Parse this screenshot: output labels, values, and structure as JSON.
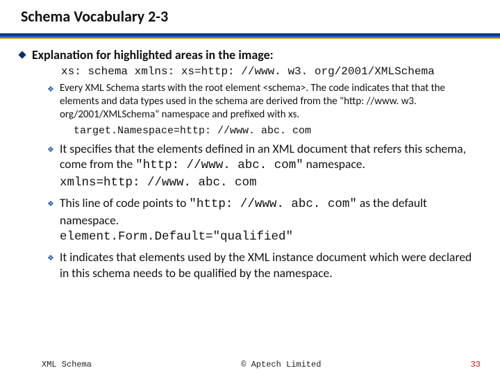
{
  "title": "Schema Vocabulary 2-3",
  "heading": "Explanation for highlighted areas in the image:",
  "code1": "xs: schema xmlns: xs=http: //www. w3. org/2001/XMLSchema",
  "item1": "Every XML Schema starts with the root element <schema>. The code indicates that that the elements and data types used in the schema are derived from the \"http: //www. w3. org/2001/XMLSchema\" namespace and prefixed with xs.",
  "code2": "target.Namespace=http: //www. abc. com",
  "item2a": "It specifies that the elements defined in an XML document that refers this schema, come from the ",
  "item2a_mono": "\"http: //www. abc. com\"",
  "item2a_tail": " namespace.",
  "code3": "xmlns=http: //www. abc. com",
  "item3a": "This line of code points to ",
  "item3a_mono": "\"http: //www. abc. com\"",
  "item3a_tail": " as the default namespace.",
  "code4": "element.Form.Default=\"qualified\"",
  "item4": "It indicates that elements used by the XML instance document which were declared in this schema needs to be qualified by the namespace.",
  "footer": {
    "left": "XML Schema",
    "center": "© Aptech Limited",
    "page": "33"
  }
}
